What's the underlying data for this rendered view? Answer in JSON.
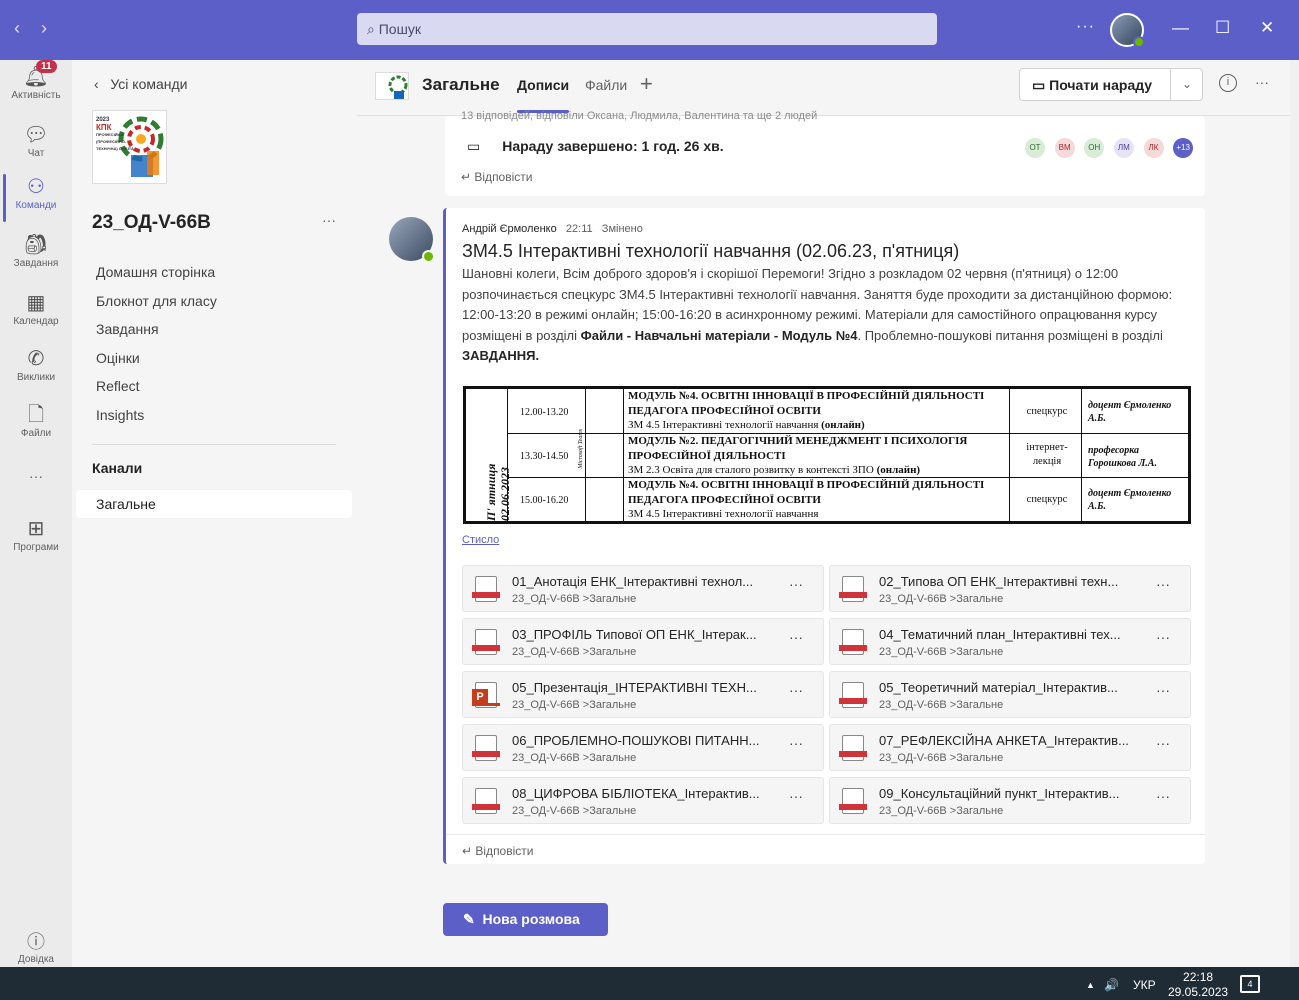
{
  "titlebar": {
    "nav_back": "‹",
    "nav_forward": "›",
    "search_placeholder": "Пошук",
    "more": "···",
    "minimize": "—",
    "maximize": "☐",
    "close": "✕"
  },
  "rail": {
    "items": [
      {
        "label": "Активність",
        "icon": "bell-icon",
        "badge": "11"
      },
      {
        "label": "Чат",
        "icon": "chat-icon"
      },
      {
        "label": "Команди",
        "icon": "teams-icon",
        "active": true
      },
      {
        "label": "Завдання",
        "icon": "assignments-icon"
      },
      {
        "label": "Календар",
        "icon": "calendar-icon"
      },
      {
        "label": "Виклики",
        "icon": "phone-icon"
      },
      {
        "label": "Файли",
        "icon": "file-icon"
      },
      {
        "label": "···",
        "icon": "more-icon"
      },
      {
        "label": "Програми",
        "icon": "apps-icon"
      }
    ],
    "help": "Довідка"
  },
  "teams_panel": {
    "back_label": "Усі команди",
    "team_name": "23_ОД-V-66В",
    "more": "···",
    "links": [
      "Домашня сторінка",
      "Блокнот для класу",
      "Завдання",
      "Оцінки",
      "Reflect",
      "Insights"
    ],
    "channels_heading": "Канали",
    "selected_channel": "Загальне",
    "logo_text": [
      "2023",
      "КПК",
      "ПРОФЕСІЙНА",
      "(ПРОФЕСІЙНО-",
      "ТЕХНІЧНА) ОСВІТА"
    ]
  },
  "header": {
    "channel_title": "Загальне",
    "tabs": [
      "Дописи",
      "Файли"
    ],
    "add_tab": "+",
    "meet_button": "Почати нараду",
    "info": "i",
    "more": "···"
  },
  "post1": {
    "replies_summary": "13 відповідей, відповіли Оксана, Людмила, Валентина та ще 2 людей",
    "meeting_ended": "Нараду завершено: 1 год. 26 хв.",
    "participants": [
      "ОТ",
      "ВМ",
      "ОН",
      "ЛМ",
      "ЛК",
      "+13"
    ],
    "reply": "Відповісти"
  },
  "post2": {
    "author": "Андрій Єрмоленко",
    "time": "22:11",
    "edited": "Змінено",
    "subject": "ЗМ4.5 Інтерактивні технології навчання (02.06.23, п'ятниця)",
    "body_1": "Шановні колеги, Всім доброго здоров'я і скорішої Перемоги! Згідно з розкладом 02 червня (п'ятниця) о 12:00 розпочинається спецкурс ЗМ4.5 Інтерактивні технології навчання. Заняття буде проходити за дистанційною формою: 12:00-13:20 в режимі онлайн; 15:00-16:20 в асинхронному режимі. Матеріали для самостійного опрацювання курсу розміщені в розділі ",
    "body_bold_1": "Файли - Навчальні матеріали - Модуль №4",
    "body_2": ". Проблемно-пошукові питання розміщені в розділі ",
    "body_bold_2": "ЗАВДАННЯ.",
    "shrink": "Стисло",
    "reply": "Відповісти",
    "schedule": {
      "day": "П' ятниця 02.06.2023",
      "platform": "Microsoft Teams",
      "rows": [
        {
          "time": "12.00-13.20",
          "module": "МОДУЛЬ №4. ОСВІТНІ ІННОВАЦІЇ В ПРОФЕСІЙНІЙ ДІЯЛЬНОСТІ ПЕДАГОГА ПРОФЕСІЙНОЇ ОСВІТИ",
          "topic": "ЗМ 4.5 Інтерактивні технології навчання ",
          "mode": "(онлайн)",
          "kind": "спецкурс",
          "lecturer": "доцент Єрмоленко А.Б."
        },
        {
          "time": "13.30-14.50",
          "module": "МОДУЛЬ №2. ПЕДАГОГІЧНИЙ МЕНЕДЖМЕНТ І ПСИХОЛОГІЯ ПРОФЕСІЙНОЇ ДІЯЛЬНОСТІ",
          "topic": "ЗМ 2.3 Освіта для сталого розвитку в контексті ЗПО ",
          "mode": "(онлайн)",
          "kind": "інтернет-лекція",
          "lecturer": "професорка Горошкова Л.А."
        },
        {
          "time": "15.00-16.20",
          "module": "МОДУЛЬ №4. ОСВІТНІ ІННОВАЦІЇ В ПРОФЕСІЙНІЙ ДІЯЛЬНОСТІ ПЕДАГОГА ПРОФЕСІЙНОЇ ОСВІТИ",
          "topic": "ЗМ 4.5 Інтерактивні технології навчання",
          "mode": "",
          "kind": "спецкурс",
          "lecturer": "доцент Єрмоленко А.Б."
        }
      ]
    },
    "files": [
      {
        "name": "01_Анотація ЕНК_Інтерактивні технол...",
        "loc": "23_ОД-V-66В >Загальне",
        "type": "pdf"
      },
      {
        "name": "02_Типова ОП ЕНК_Інтерактивні техн...",
        "loc": "23_ОД-V-66В >Загальне",
        "type": "pdf"
      },
      {
        "name": "03_ПРОФІЛЬ Типової ОП ЕНК_Інтерак...",
        "loc": "23_ОД-V-66В >Загальне",
        "type": "pdf"
      },
      {
        "name": "04_Тематичний план_Інтерактивні тех...",
        "loc": "23_ОД-V-66В >Загальне",
        "type": "pdf"
      },
      {
        "name": "05_Презентація_ІНТЕРАКТИВНІ ТЕХН...",
        "loc": "23_ОД-V-66В >Загальне",
        "type": "ppt"
      },
      {
        "name": "05_Теоретичний матеріал_Інтерактив...",
        "loc": "23_ОД-V-66В >Загальне",
        "type": "pdf"
      },
      {
        "name": "06_ПРОБЛЕМНО-ПОШУКОВІ ПИТАНН...",
        "loc": "23_ОД-V-66В >Загальне",
        "type": "pdf"
      },
      {
        "name": "07_РЕФЛЕКСІЙНА АНКЕТА_Інтерактив...",
        "loc": "23_ОД-V-66В >Загальне",
        "type": "pdf"
      },
      {
        "name": "08_ЦИФРОВА БІБЛІОТЕКА_Інтерактив...",
        "loc": "23_ОД-V-66В >Загальне",
        "type": "pdf"
      },
      {
        "name": "09_Консультаційний пункт_Інтерактив...",
        "loc": "23_ОД-V-66В >Загальне",
        "type": "pdf"
      }
    ],
    "file_more": "···"
  },
  "new_conversation": "Нова розмова",
  "taskbar": {
    "chevron": "▲",
    "volume": "🔊",
    "lang": "УКР",
    "time": "22:18",
    "date": "29.05.2023",
    "notifications": "4"
  },
  "colors": {
    "brand": "#5b5fc7",
    "badge": "#c4314b",
    "presence": "#6bb700"
  }
}
